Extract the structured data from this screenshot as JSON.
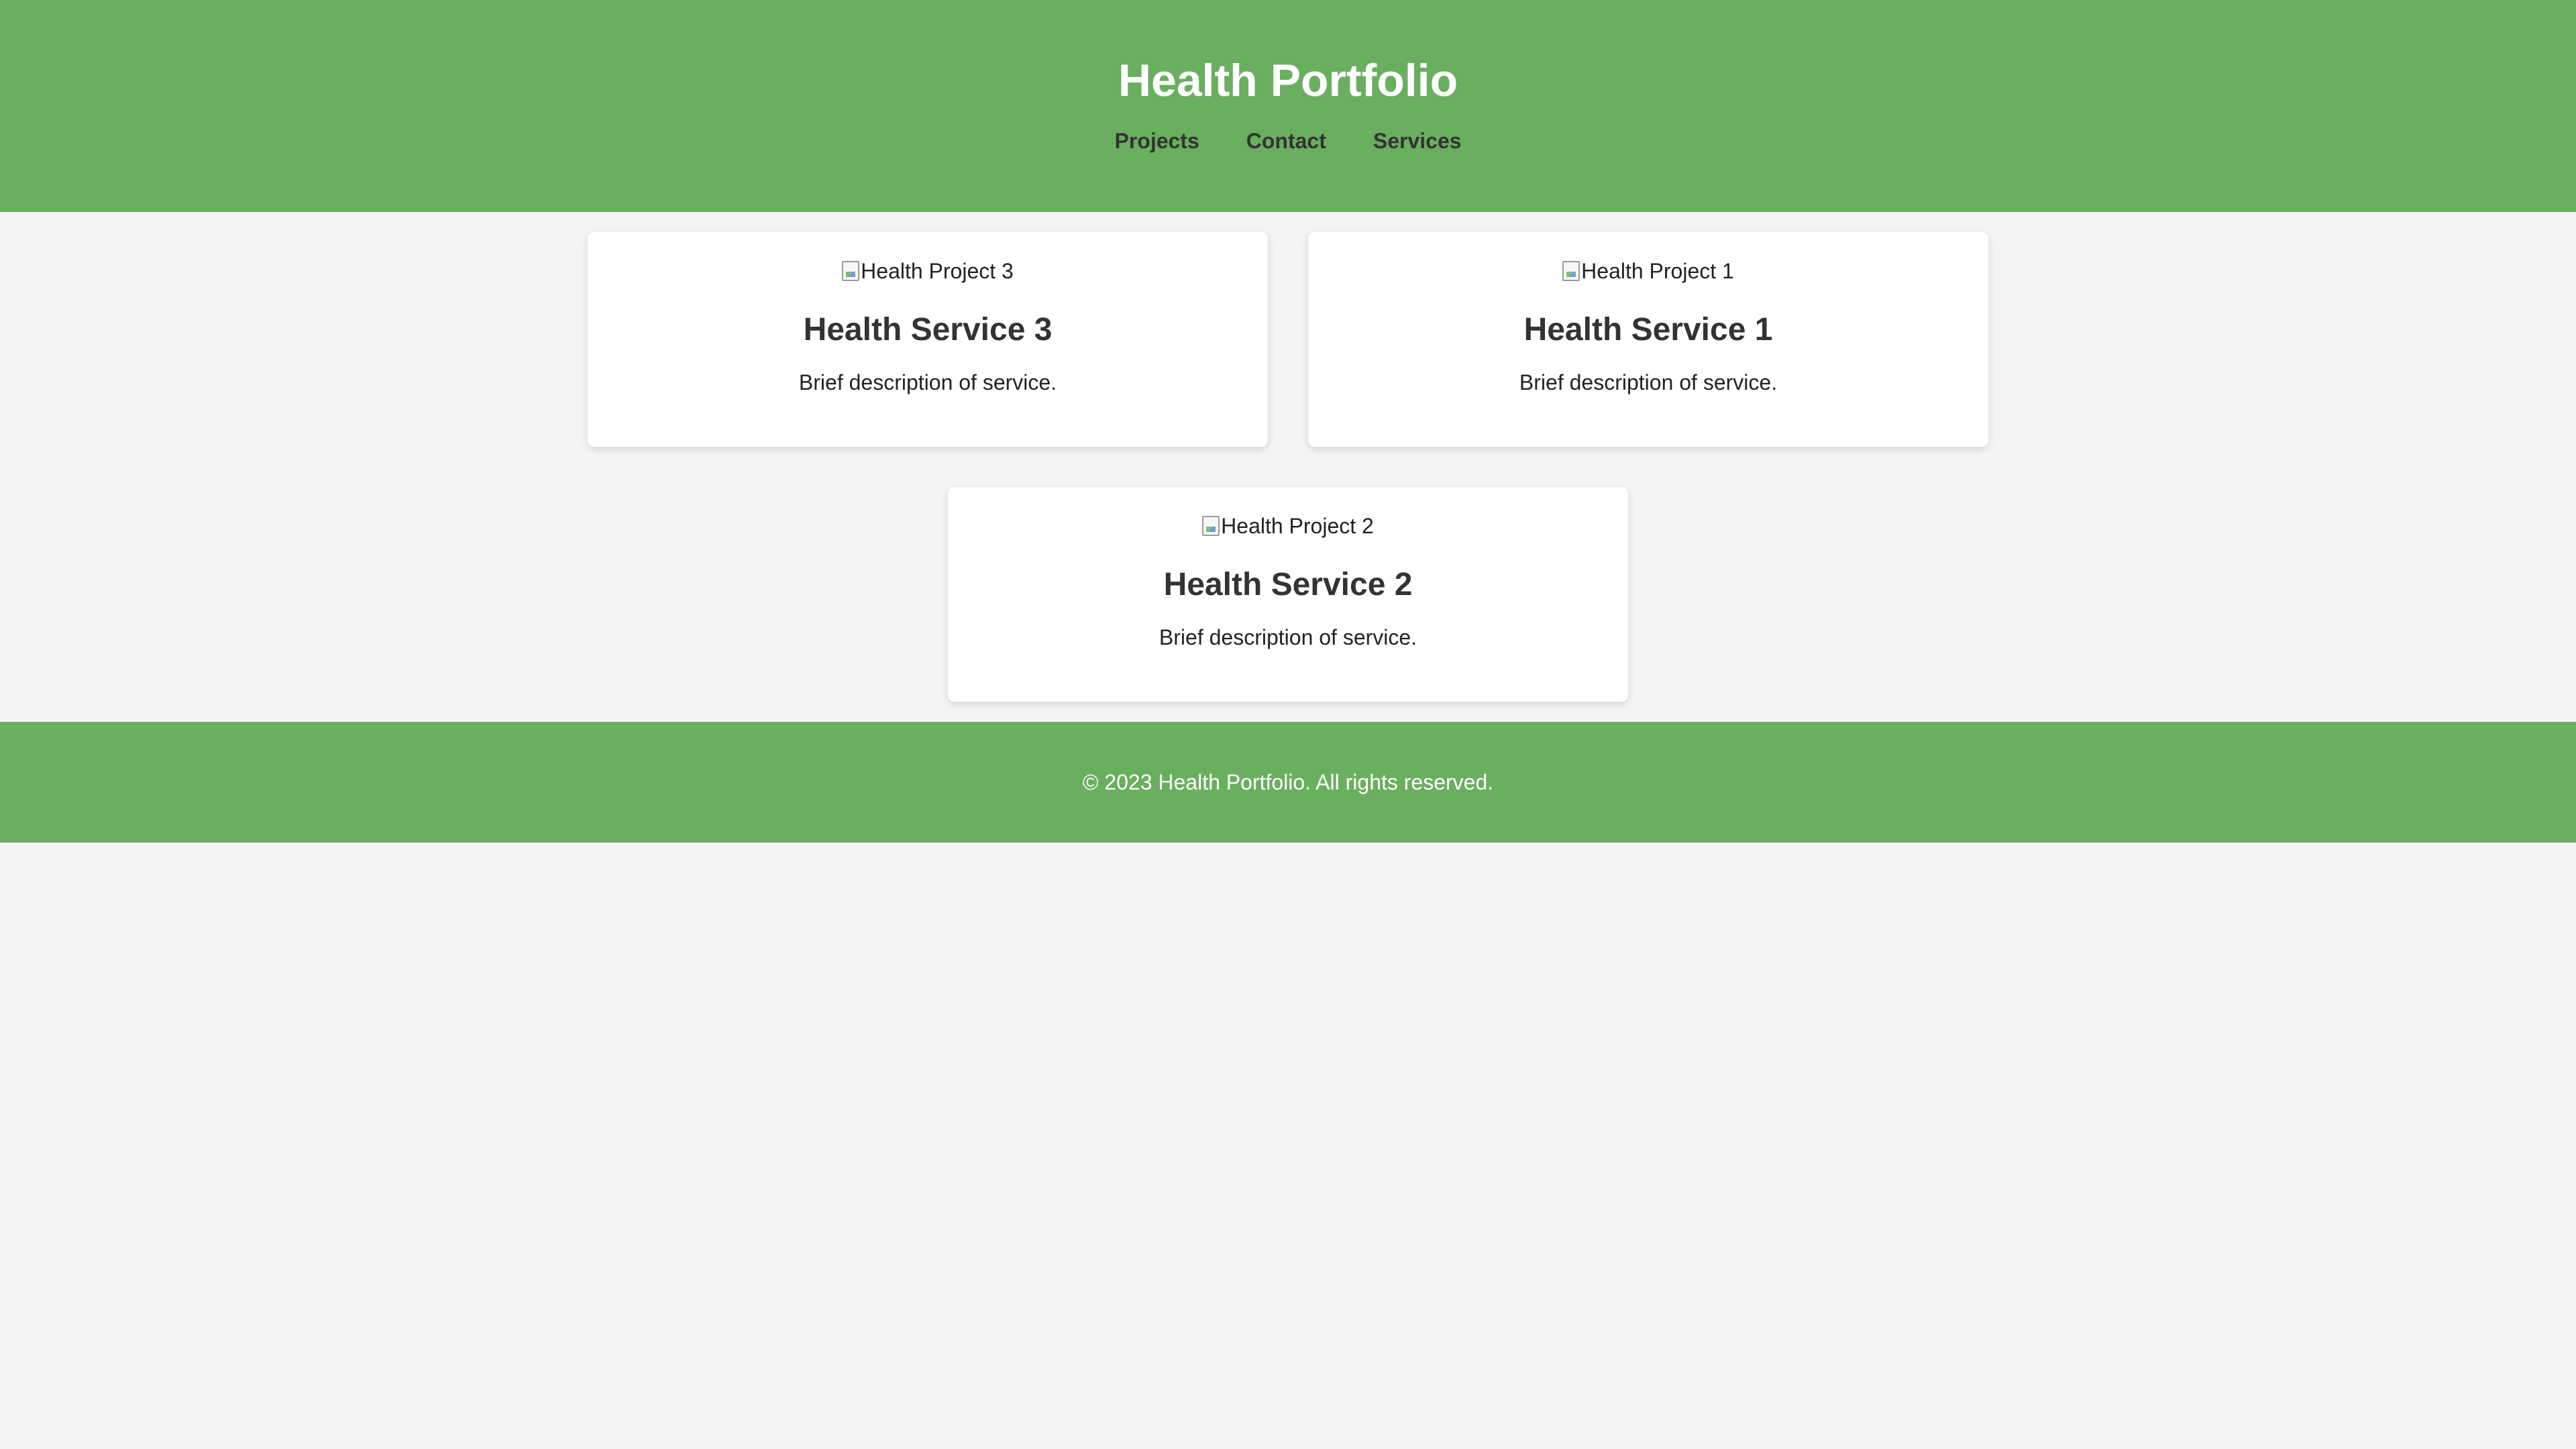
{
  "header": {
    "title": "Health Portfolio",
    "nav": [
      {
        "label": "Projects"
      },
      {
        "label": "Contact"
      },
      {
        "label": "Services"
      }
    ]
  },
  "cards": [
    {
      "image_alt": "Health Project 3",
      "title": "Health Service 3",
      "description": "Brief description of service."
    },
    {
      "image_alt": "Health Project 1",
      "title": "Health Service 1",
      "description": "Brief description of service."
    },
    {
      "image_alt": "Health Project 2",
      "title": "Health Service 2",
      "description": "Brief description of service."
    }
  ],
  "footer": {
    "text": "© 2023 Health Portfolio. All rights reserved."
  },
  "colors": {
    "header_bg": "#6aaf5f",
    "page_bg": "#f4f4f4",
    "card_bg": "#ffffff",
    "text_dark": "#333333"
  },
  "icons": {
    "broken_image": "broken-image-icon"
  }
}
